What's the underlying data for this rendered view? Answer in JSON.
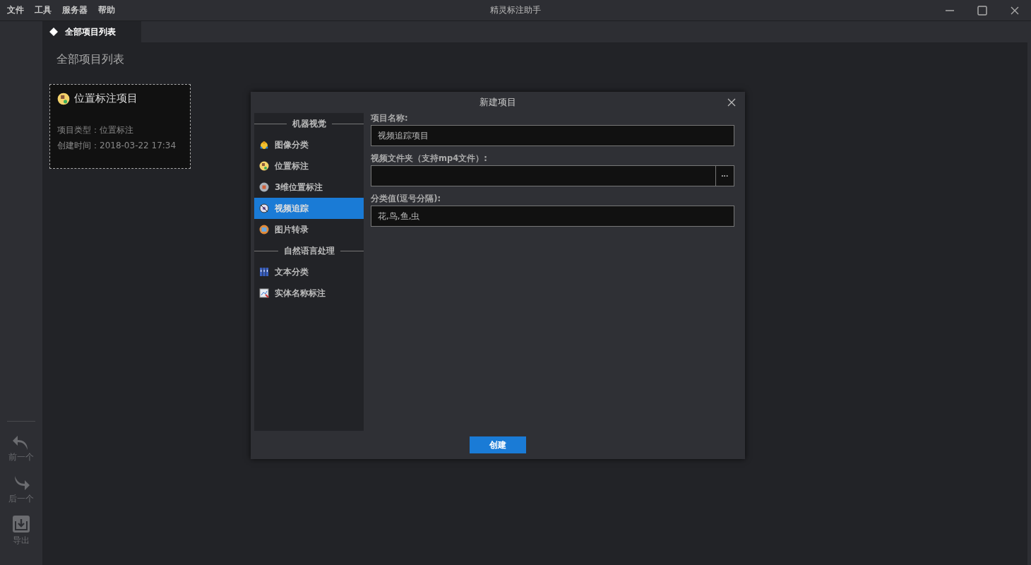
{
  "menu": [
    "文件",
    "工具",
    "服务器",
    "帮助"
  ],
  "window": {
    "title": "精灵标注助手"
  },
  "rail": [
    {
      "label": "前一个",
      "kind": "prev"
    },
    {
      "label": "后一个",
      "kind": "next"
    },
    {
      "label": "导出",
      "kind": "export"
    }
  ],
  "tabs": [
    {
      "label": "全部项目列表",
      "selected": true
    }
  ],
  "page_title": "全部项目列表",
  "projects": [
    {
      "name": "位置标注项目",
      "type": "项目类型：位置标注",
      "created": "创建时间：2018-03-22 17:34"
    }
  ],
  "dialog": {
    "title": "新建项目",
    "categories": [
      {
        "kind": "header",
        "label": "机器视觉"
      },
      {
        "kind": "item",
        "label": "图像分类",
        "selected": false
      },
      {
        "kind": "item",
        "label": "位置标注",
        "selected": false
      },
      {
        "kind": "item",
        "label": "3维位置标注",
        "selected": false
      },
      {
        "kind": "item",
        "label": "视频追踪",
        "selected": true
      },
      {
        "kind": "item",
        "label": "图片转录",
        "selected": false
      },
      {
        "kind": "header",
        "label": "自然语言处理"
      },
      {
        "kind": "item",
        "label": "文本分类",
        "selected": false
      },
      {
        "kind": "item",
        "label": "实体名称标注",
        "selected": false
      }
    ],
    "fields": [
      {
        "label": "项目名称:",
        "value": "视频追踪项目",
        "kind": "text"
      },
      {
        "label": "视频文件夹（支持mp4文件）:",
        "kind": "folder",
        "browse": "···"
      },
      {
        "label": "分类值(逗号分隔):",
        "value": "花,鸟,鱼,虫",
        "kind": "text"
      }
    ],
    "create_button": "创建"
  }
}
